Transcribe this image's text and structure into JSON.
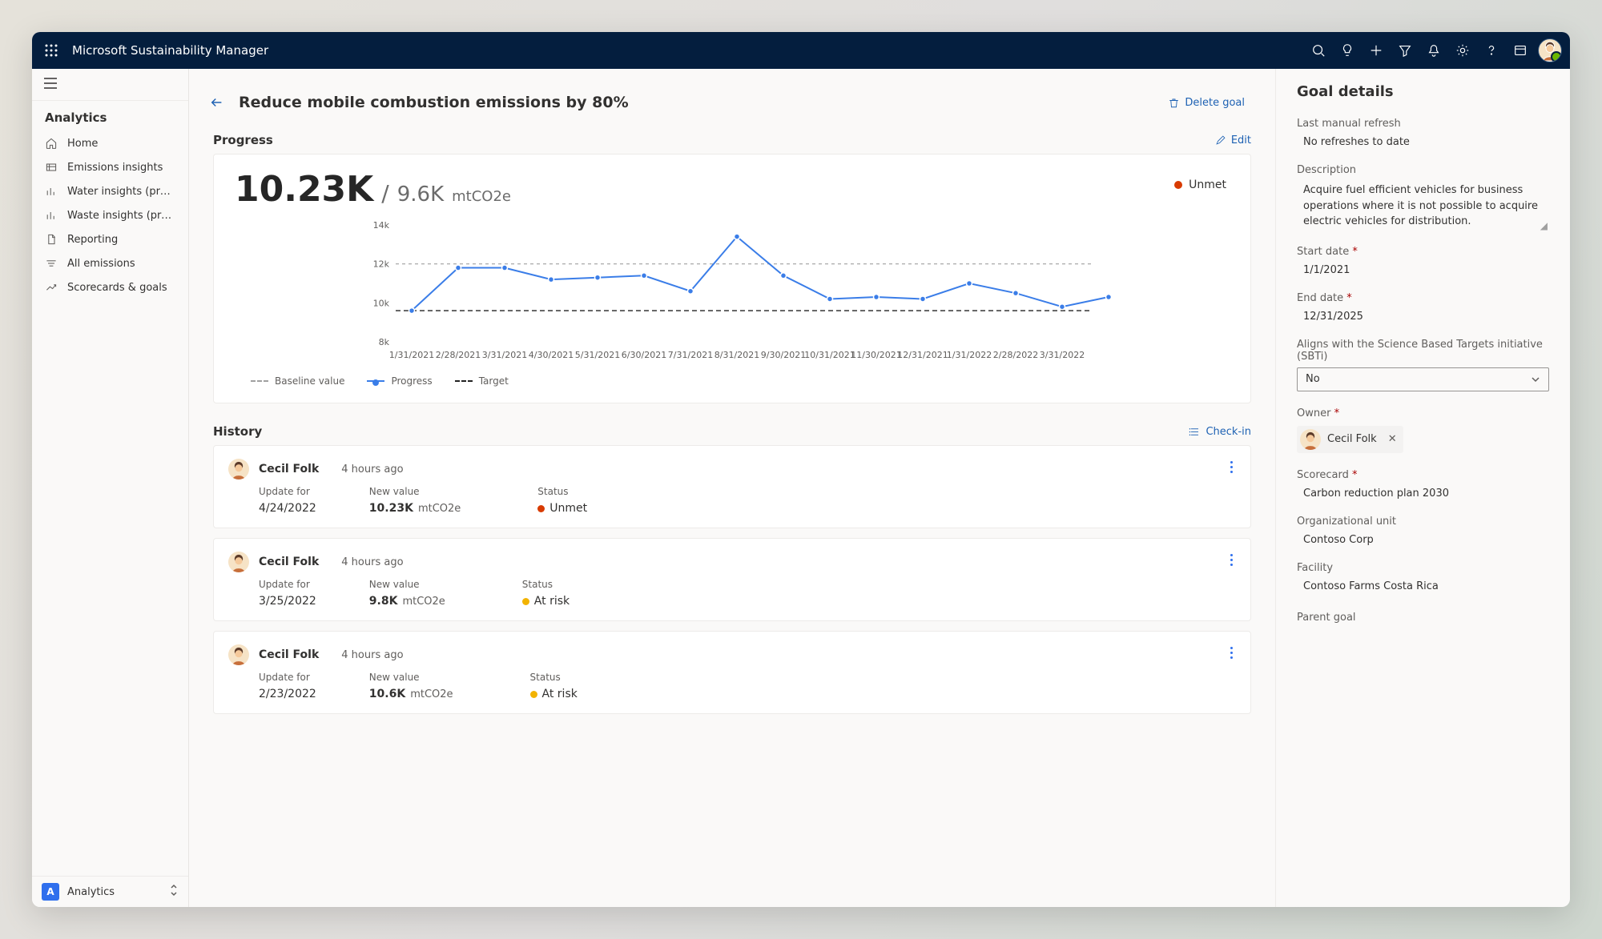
{
  "app_title": "Microsoft Sustainability Manager",
  "sidebar": {
    "section": "Analytics",
    "items": [
      {
        "label": "Home"
      },
      {
        "label": "Emissions insights"
      },
      {
        "label": "Water insights (previ..."
      },
      {
        "label": "Waste insights (previ..."
      },
      {
        "label": "Reporting"
      },
      {
        "label": "All emissions"
      },
      {
        "label": "Scorecards & goals"
      }
    ],
    "footer_label": "Analytics",
    "footer_badge": "A"
  },
  "page": {
    "title": "Reduce mobile combustion emissions by 80%",
    "delete_label": "Delete goal"
  },
  "progress": {
    "section_label": "Progress",
    "edit_label": "Edit",
    "current": "10.23K",
    "sep": "/",
    "target": "9.6K",
    "unit": "mtCO2e",
    "status": "Unmet",
    "legend_baseline": "Baseline value",
    "legend_progress": "Progress",
    "legend_target": "Target"
  },
  "history": {
    "section_label": "History",
    "checkin_label": "Check-in",
    "col_update": "Update for",
    "col_newvalue": "New value",
    "col_status": "Status",
    "entries": [
      {
        "name": "Cecil Folk",
        "time": "4 hours ago",
        "date": "4/24/2022",
        "value": "10.23K",
        "unit": "mtCO2e",
        "status": "Unmet",
        "dot": "red"
      },
      {
        "name": "Cecil Folk",
        "time": "4 hours ago",
        "date": "3/25/2022",
        "value": "9.8K",
        "unit": "mtCO2e",
        "status": "At risk",
        "dot": "yellow"
      },
      {
        "name": "Cecil Folk",
        "time": "4 hours ago",
        "date": "2/23/2022",
        "value": "10.6K",
        "unit": "mtCO2e",
        "status": "At risk",
        "dot": "yellow"
      }
    ]
  },
  "details": {
    "title": "Goal details",
    "last_refresh_label": "Last manual refresh",
    "last_refresh_value": "No refreshes to date",
    "description_label": "Description",
    "description_value": "Acquire fuel efficient vehicles for business operations where it is not possible to acquire electric vehicles for distribution.",
    "start_date_label": "Start date",
    "start_date_value": "1/1/2021",
    "end_date_label": "End date",
    "end_date_value": "12/31/2025",
    "sbti_label": "Aligns with the Science Based Targets initiative (SBTi)",
    "sbti_value": "No",
    "owner_label": "Owner",
    "owner_value": "Cecil Folk",
    "scorecard_label": "Scorecard",
    "scorecard_value": "Carbon reduction plan 2030",
    "ou_label": "Organizational unit",
    "ou_value": "Contoso Corp",
    "facility_label": "Facility",
    "facility_value": "Contoso Farms Costa Rica",
    "parent_label": "Parent goal"
  },
  "chart_data": {
    "type": "line",
    "ylabel": "",
    "ylim": [
      8000,
      14000
    ],
    "yticks": [
      "14k",
      "12k",
      "10k",
      "8k"
    ],
    "baseline": 12000,
    "target": 9600,
    "categories": [
      "1/31/2021",
      "2/28/2021",
      "3/31/2021",
      "4/30/2021",
      "5/31/2021",
      "6/30/2021",
      "7/31/2021",
      "8/31/2021",
      "9/30/2021",
      "10/31/2021",
      "11/30/2021",
      "12/31/2021",
      "1/31/2022",
      "2/28/2022",
      "3/31/2022"
    ],
    "series": [
      {
        "name": "Progress",
        "values": [
          9600,
          11800,
          11800,
          11200,
          11300,
          11400,
          10600,
          13400,
          11400,
          10200,
          10300,
          10200,
          11000,
          10500,
          9800,
          10300
        ]
      }
    ]
  }
}
